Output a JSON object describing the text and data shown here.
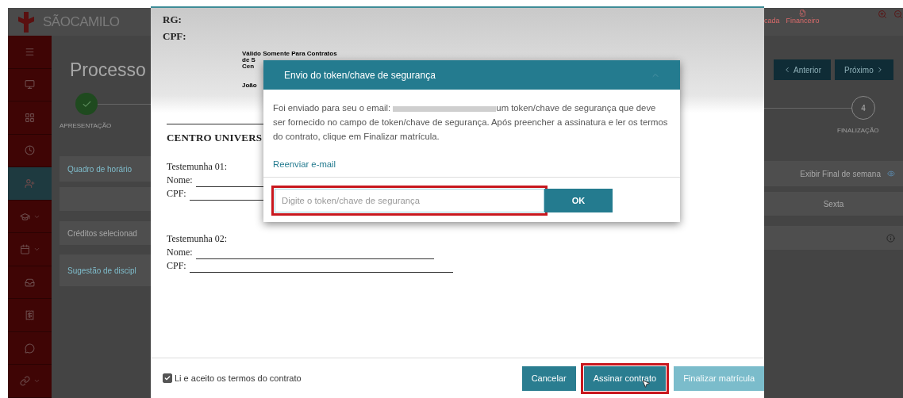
{
  "app": {
    "logo_text": "SÃOCAMILO",
    "header_links": [
      {
        "label": "cada"
      },
      {
        "label": "Financeiro"
      }
    ],
    "page_title": "Processo",
    "nav_buttons": [
      {
        "label": "Anterior",
        "kind": "prev"
      },
      {
        "label": "Próximo",
        "kind": "next"
      }
    ],
    "steps": [
      {
        "label": "APRESENTAÇÃO",
        "done": true
      },
      {
        "label": "FINALIZAÇÃO",
        "number": "4",
        "done": false
      }
    ],
    "sidebar": {
      "items": [
        {
          "selected": false,
          "has_submenu": false
        },
        {
          "selected": false,
          "has_submenu": false
        },
        {
          "selected": false,
          "has_submenu": false
        },
        {
          "selected": false,
          "has_submenu": false
        },
        {
          "selected": true,
          "has_submenu": false
        },
        {
          "selected": false,
          "has_submenu": true
        },
        {
          "selected": false,
          "has_submenu": true
        },
        {
          "selected": false,
          "has_submenu": false
        },
        {
          "selected": false,
          "has_submenu": false
        },
        {
          "selected": false,
          "has_submenu": false
        },
        {
          "selected": false,
          "has_submenu": true
        }
      ]
    },
    "schedule": {
      "title": "Quadro de horário",
      "weekend_toggle": "Exibir Final de semana",
      "day_column": "Sexta"
    },
    "credits": {
      "label": "Créditos selecionad"
    },
    "suggestions": {
      "label": "Sugestão de discipl"
    }
  },
  "contract_modal": {
    "document": {
      "id_fields": [
        "RG:",
        "CPF:"
      ],
      "stamp_lines": [
        "Válido Somente Para Contratos",
        "de S",
        "Cen",
        "João"
      ],
      "institution": "CENTRO UNIVERS",
      "witnesses": [
        {
          "title": "Testemunha 01:",
          "fields": [
            "Nome:",
            "CPF:"
          ]
        },
        {
          "title": "Testemunha 02:",
          "fields": [
            "Nome:",
            "CPF:"
          ]
        }
      ]
    },
    "accept": {
      "label": "Li e aceito os termos do contrato",
      "checked": true
    },
    "buttons": [
      {
        "label": "Cancelar",
        "disabled": false,
        "highlighted": false
      },
      {
        "label": "Assinar contrato",
        "disabled": false,
        "highlighted": true
      },
      {
        "label": "Finalizar matrícula",
        "disabled": true,
        "highlighted": false
      }
    ]
  },
  "token_dialog": {
    "title": "Envio do token/chave de segurança",
    "message_before": "Foi enviado para seu o email:",
    "message_after": "um token/chave de segurança que deve ser fornecido no campo de token/chave de segurança. Após preencher a assinatura e ler os termos do contrato, clique em Finalizar matrícula.",
    "resend_link": "Reenviar e-mail",
    "token_field": {
      "placeholder": "Digite o token/chave de segurança",
      "highlighted": true
    },
    "ok_button": "OK"
  }
}
